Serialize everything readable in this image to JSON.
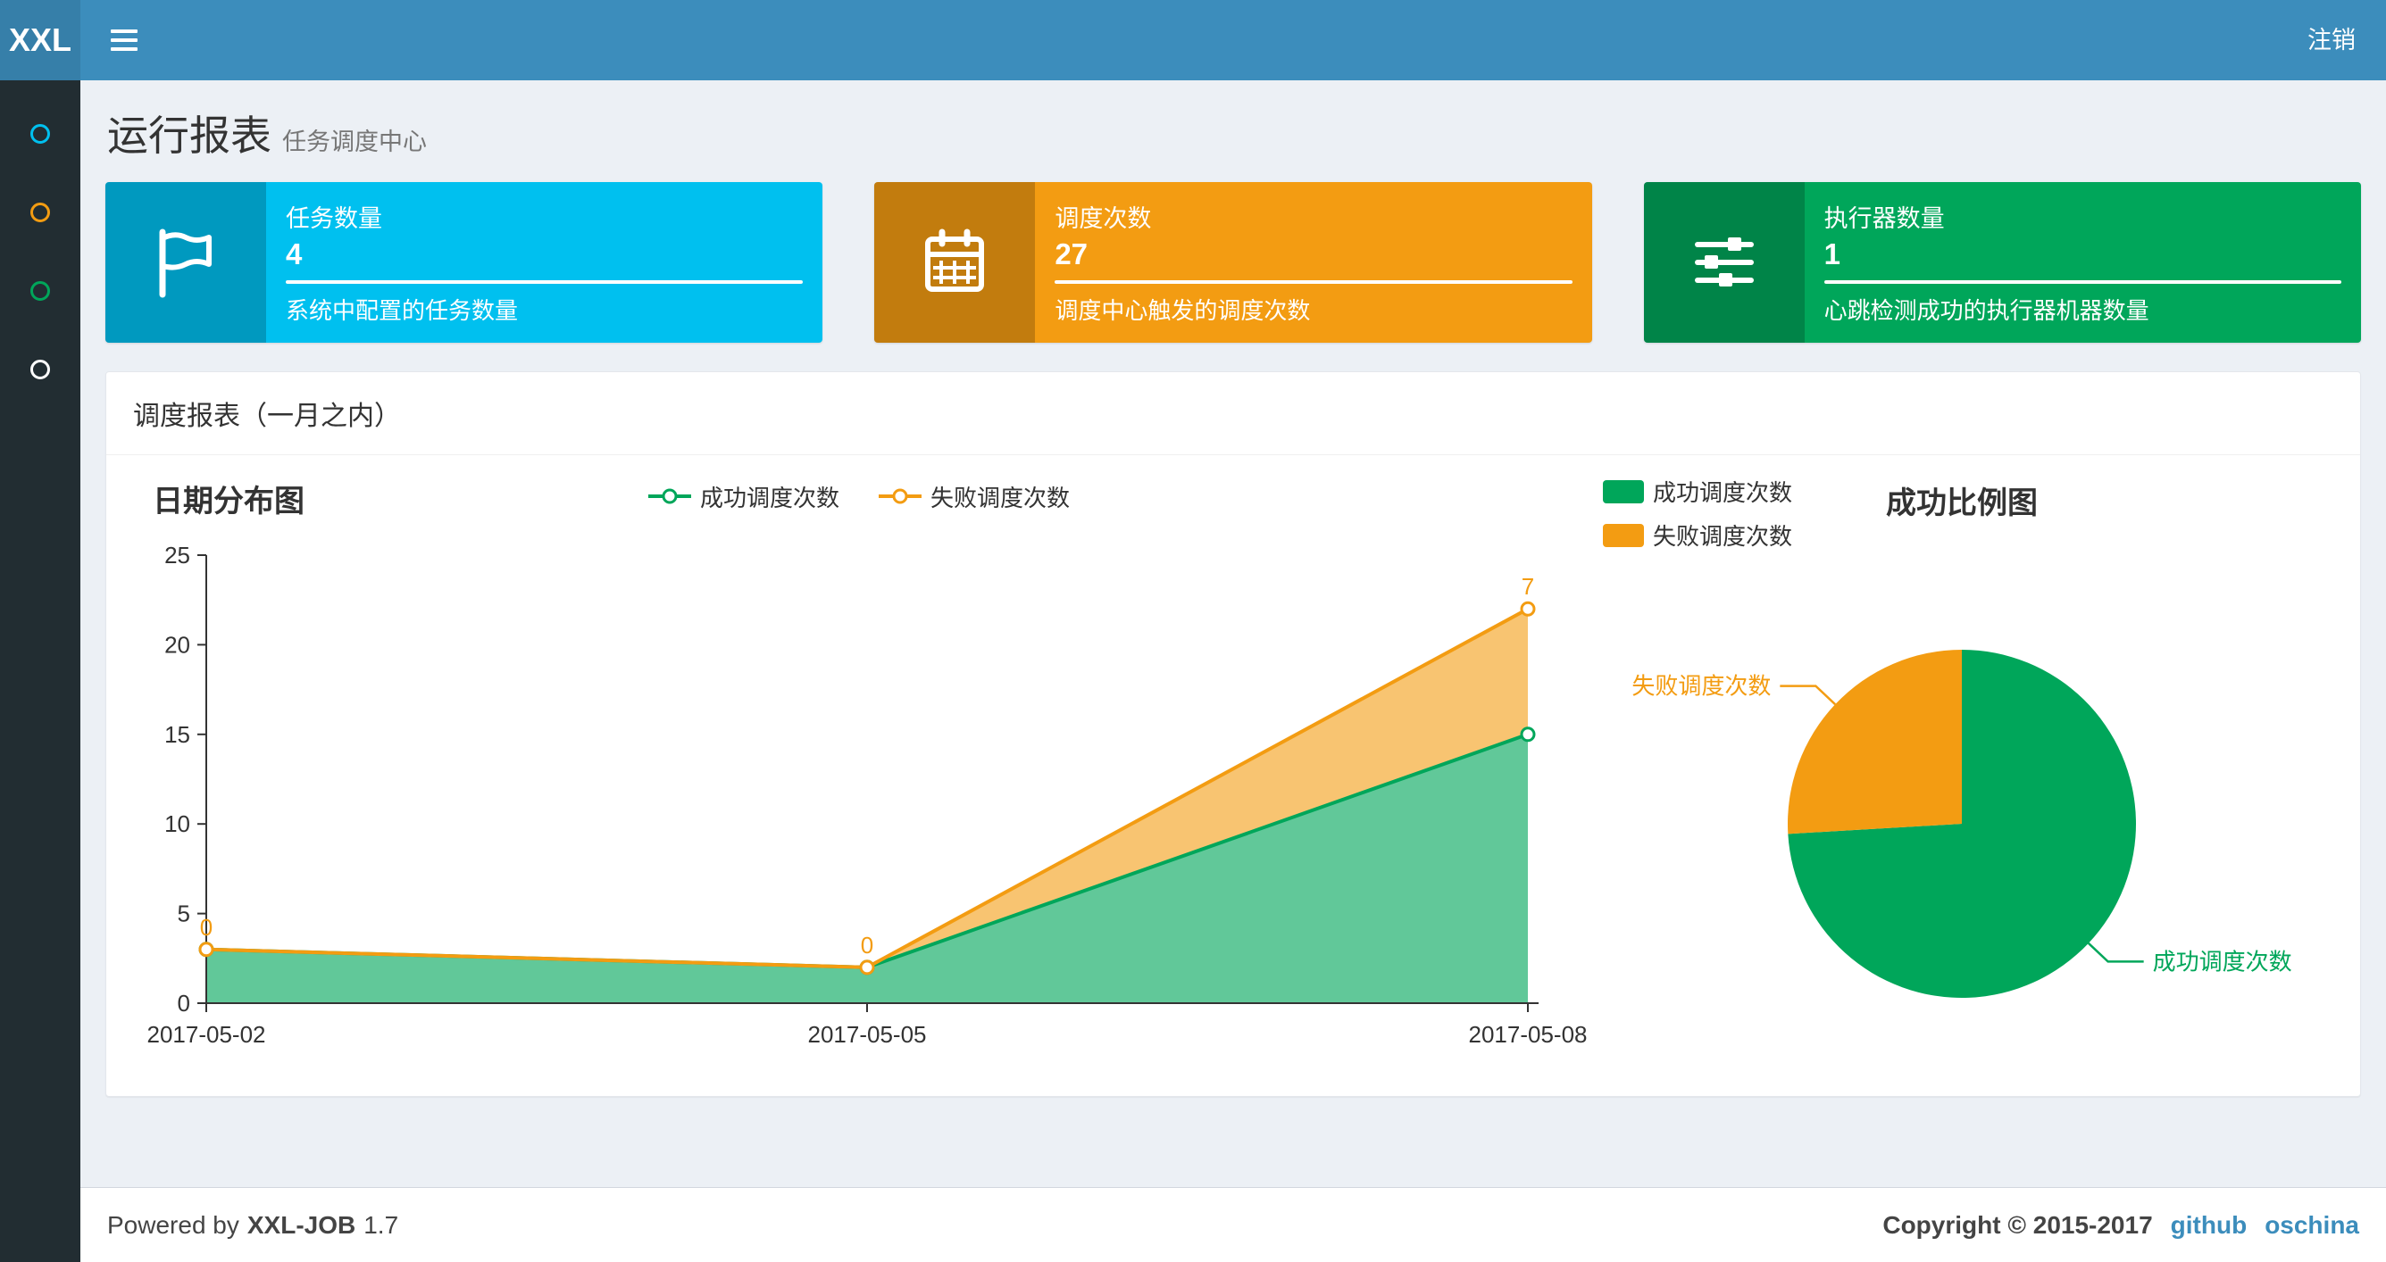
{
  "navbar": {
    "logo": "XXL",
    "logout_label": "注销"
  },
  "sidebar": {
    "items": [
      {
        "id": "report",
        "color": "#00c0ef"
      },
      {
        "id": "job",
        "color": "#f39c12"
      },
      {
        "id": "log",
        "color": "#00a65a"
      },
      {
        "id": "help",
        "color": "#ffffff"
      }
    ]
  },
  "page": {
    "title": "运行报表",
    "subtitle": "任务调度中心"
  },
  "info_boxes": [
    {
      "title": "任务数量",
      "value": "4",
      "description": "系统中配置的任务数量",
      "color": "#00c0ef",
      "icon": "flag-icon"
    },
    {
      "title": "调度次数",
      "value": "27",
      "description": "调度中心触发的调度次数",
      "color": "#f39c12",
      "icon": "calendar-icon"
    },
    {
      "title": "执行器数量",
      "value": "1",
      "description": "心跳检测成功的执行器机器数量",
      "color": "#00a65a",
      "icon": "sliders-icon"
    }
  ],
  "panel": {
    "title": "调度报表（一月之内）"
  },
  "chart_data": [
    {
      "type": "area",
      "title": "日期分布图",
      "stacked": true,
      "grid": false,
      "legend_position": "top-center",
      "categories": [
        "2017-05-02",
        "2017-05-05",
        "2017-05-08"
      ],
      "series": [
        {
          "name": "成功调度次数",
          "color": "#00a65a",
          "values": [
            3,
            2,
            15
          ]
        },
        {
          "name": "失败调度次数",
          "color": "#f39c12",
          "values": [
            0,
            0,
            7
          ],
          "point_labels": [
            "0",
            "0",
            "7"
          ]
        }
      ],
      "ylim": [
        0,
        25
      ],
      "yticks": [
        0,
        5,
        10,
        15,
        20,
        25
      ]
    },
    {
      "type": "pie",
      "title": "成功比例图",
      "legend_position": "top-left",
      "slices": [
        {
          "name": "成功调度次数",
          "value": 20,
          "color": "#00a65a"
        },
        {
          "name": "失败调度次数",
          "value": 7,
          "color": "#f39c12"
        }
      ]
    }
  ],
  "footer": {
    "powered_by": "Powered by",
    "product": "XXL-JOB",
    "version": "1.7",
    "copyright": "Copyright © 2015-2017",
    "links": [
      {
        "label": "github"
      },
      {
        "label": "oschina"
      }
    ]
  },
  "colors": {
    "navbar": "#3c8dbc",
    "logo_bg": "#367fa9",
    "sidebar_bg": "#222d32",
    "content_bg": "#ecf0f5",
    "success": "#00a65a",
    "fail": "#f39c12",
    "aqua": "#00c0ef"
  }
}
